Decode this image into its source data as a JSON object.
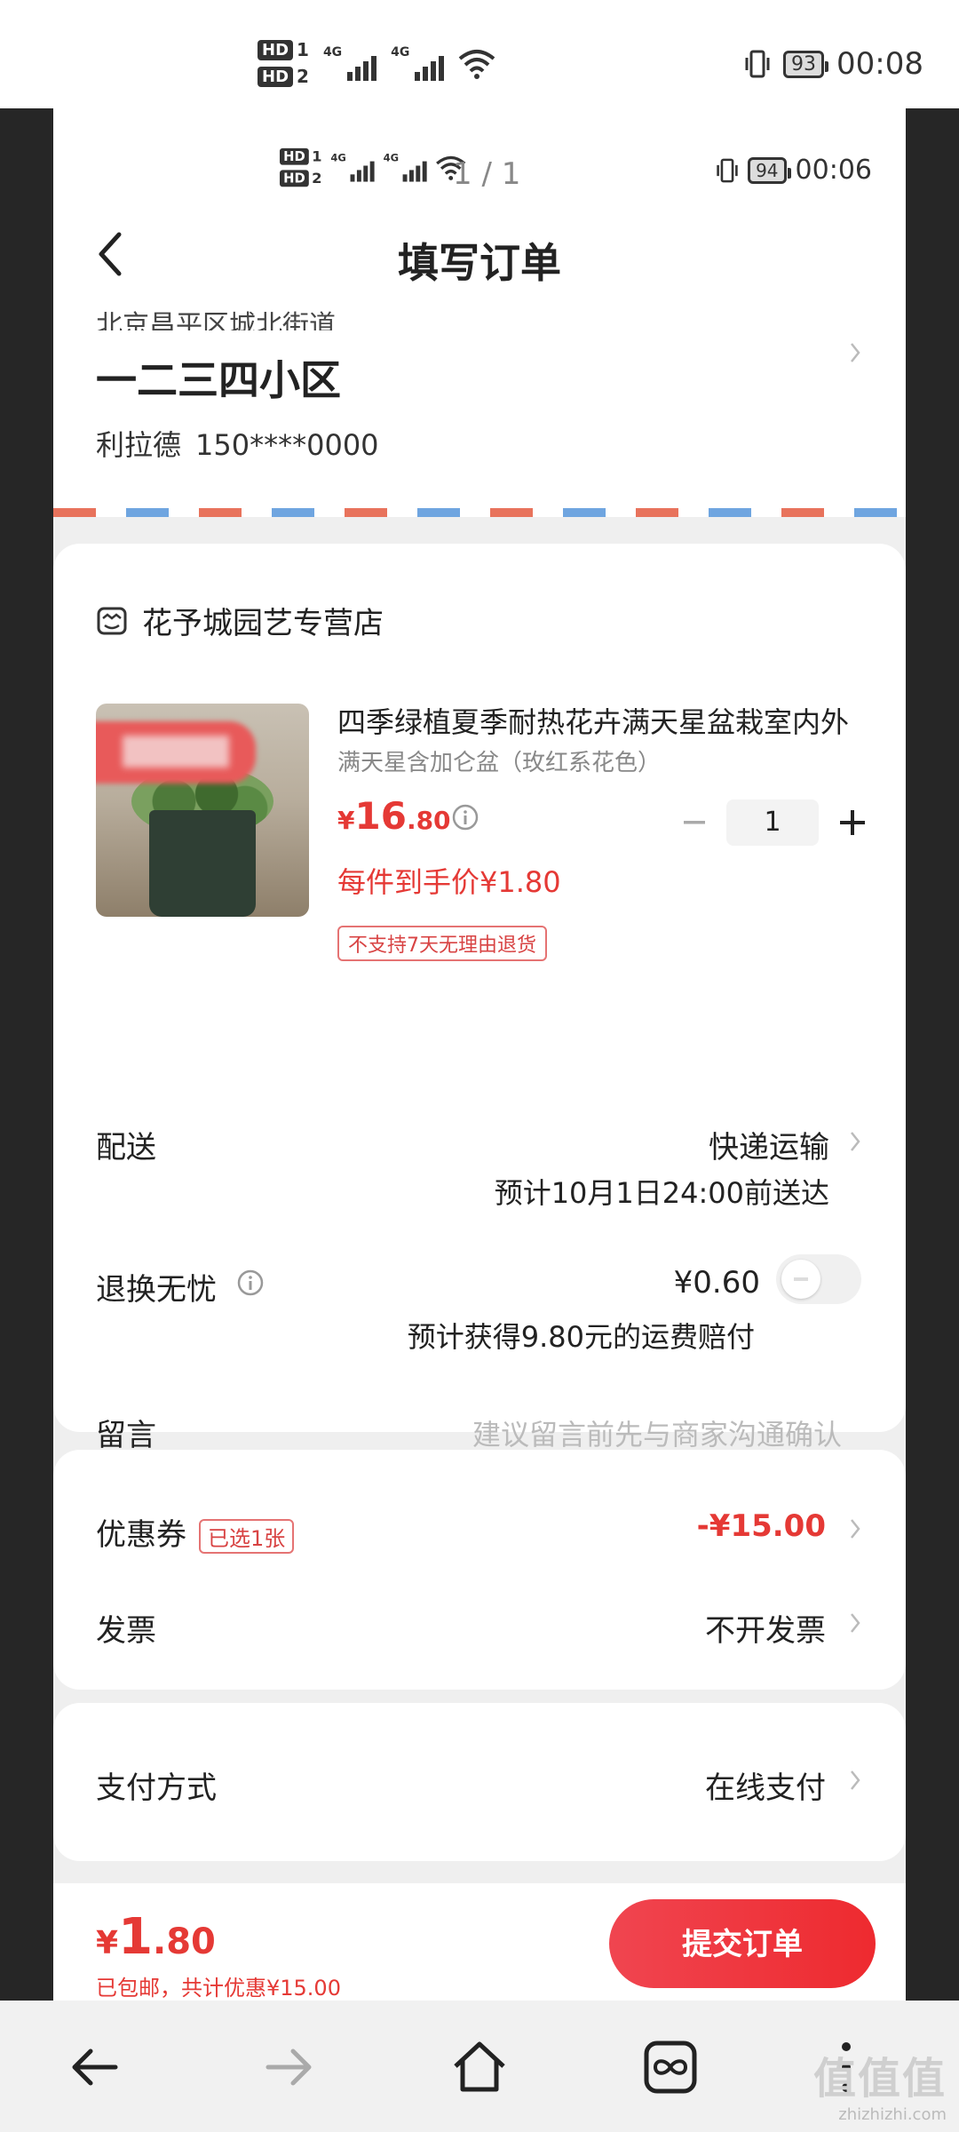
{
  "outer_status": {
    "time": "00:08",
    "battery": "93",
    "hd1": "HD",
    "hd2": "HD",
    "sim1": "1",
    "sim2": "2",
    "net": "4G"
  },
  "inner_status": {
    "time": "00:06",
    "battery": "94",
    "page_indicator": "1 / 1"
  },
  "header": {
    "title": "填写订单"
  },
  "address": {
    "line": "北京昌平区城北街道",
    "name": "一二三四小区",
    "recipient": "利拉德",
    "phone": "150****0000"
  },
  "store": {
    "name": "花予城园艺专营店",
    "product": {
      "title": "四季绿植夏季耐热花卉满天星盆栽室内外",
      "spec": "满天星含加仑盆（玫红系花色）",
      "price_currency": "¥",
      "price_int": "16",
      "price_dec": ".80",
      "quantity": "1",
      "unit_price": "每件到手价¥1.80",
      "return_policy": "不支持7天无理由退货"
    },
    "delivery": {
      "label": "配送",
      "value": "快递运输",
      "eta": "预计10月1日24:00前送达"
    },
    "return_insurance": {
      "label": "退换无忧",
      "price": "¥0.60",
      "note": "预计获得9.80元的运费赔付",
      "enabled": false
    },
    "message": {
      "label": "留言",
      "placeholder": "建议留言前先与商家沟通确认"
    }
  },
  "coupon": {
    "label": "优惠券",
    "tag": "已选1张",
    "value": "-¥15.00"
  },
  "invoice": {
    "label": "发票",
    "value": "不开发票"
  },
  "payment": {
    "label": "支付方式",
    "value": "在线支付"
  },
  "bottom": {
    "currency": "¥",
    "total_int": "1",
    "total_dec": ".80",
    "shipping_note": "已包邮，",
    "discount_note": "共计优惠¥15.00",
    "submit_label": "提交订单"
  },
  "watermark": {
    "big": "值值值",
    "small": "zhizhizhi.com"
  },
  "colors": {
    "accent": "#e53935",
    "submit": "#ee2a2f",
    "text": "#222222",
    "muted": "#888888"
  }
}
